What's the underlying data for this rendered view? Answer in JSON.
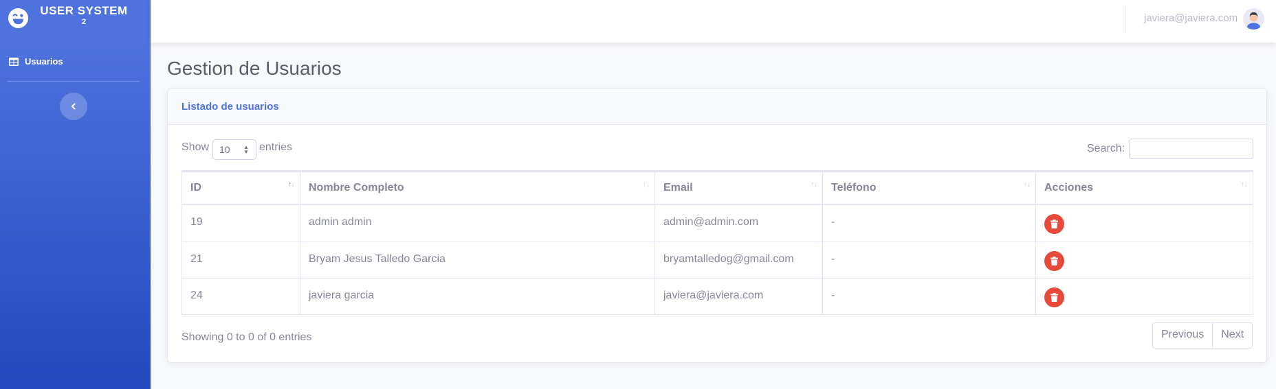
{
  "brand": {
    "title": "USER SYSTEM",
    "superscript": "2",
    "logo_icon": "laugh-wink-icon"
  },
  "sidebar": {
    "items": [
      {
        "label": "Usuarios",
        "icon": "table-icon"
      }
    ],
    "toggle_icon": "chevron-left-icon"
  },
  "topbar": {
    "user_email": "javiera@javiera.com",
    "avatar_icon": "user-avatar"
  },
  "page": {
    "title": "Gestion de Usuarios"
  },
  "card": {
    "title": "Listado de usuarios",
    "length": {
      "before": "Show",
      "selected": "10",
      "after": "entries"
    },
    "search": {
      "label": "Search:",
      "value": ""
    },
    "table": {
      "headers": [
        "ID",
        "Nombre Completo",
        "Email",
        "Teléfono",
        "Acciones"
      ],
      "rows": [
        {
          "id": "19",
          "name": "admin admin",
          "email": "admin@admin.com",
          "phone": "-"
        },
        {
          "id": "21",
          "name": "Bryam Jesus Talledo Garcia",
          "email": "bryamtalledog@gmail.com",
          "phone": "-"
        },
        {
          "id": "24",
          "name": "javiera garcia",
          "email": "javiera@javiera.com",
          "phone": "-"
        }
      ],
      "action_icon": "trash-icon"
    },
    "info": "Showing 0 to 0 of 0 entries",
    "pagination": {
      "previous": "Previous",
      "next": "Next"
    }
  },
  "colors": {
    "primary": "#4e73df",
    "danger": "#e74a3b",
    "text": "#858796",
    "title": "#5a5c69"
  }
}
